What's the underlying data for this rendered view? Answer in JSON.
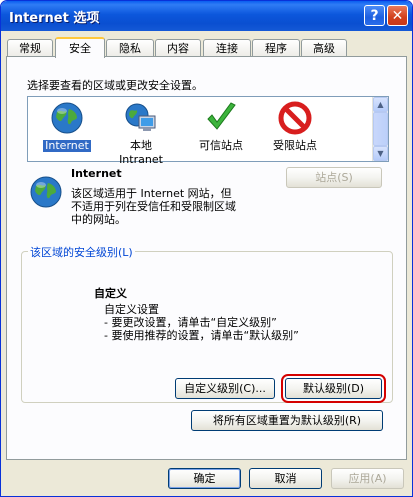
{
  "window": {
    "title": "Internet 选项",
    "help_label": "?",
    "close_label": "✕"
  },
  "tabs": [
    {
      "label": "常规",
      "active": false
    },
    {
      "label": "安全",
      "active": true
    },
    {
      "label": "隐私",
      "active": false
    },
    {
      "label": "内容",
      "active": false
    },
    {
      "label": "连接",
      "active": false
    },
    {
      "label": "程序",
      "active": false
    },
    {
      "label": "高级",
      "active": false
    }
  ],
  "zones": {
    "prompt": "选择要查看的区域或更改安全设置。",
    "items": [
      {
        "label": "Internet",
        "icon": "globe-icon",
        "selected": true
      },
      {
        "label": "本地\nIntranet",
        "line1": "本地",
        "line2": "Intranet",
        "icon": "intranet-icon",
        "selected": false
      },
      {
        "label": "可信站点",
        "icon": "checkmark-icon",
        "selected": false
      },
      {
        "label": "受限站点",
        "icon": "restricted-icon",
        "selected": false
      }
    ]
  },
  "zone_detail": {
    "name": "Internet",
    "description_line1": "该区域适用于 Internet 网站，但",
    "description_line2": "不适用于列在受信任和受限制区域",
    "description_line3": "中的网站。",
    "sites_button": "站点(S)",
    "sites_button_key": "S"
  },
  "security_level": {
    "group_title": "该区域的安全级别(L)",
    "level_name": "自定义",
    "line1": "自定义设置",
    "line2": "- 要更改设置，请单击“自定义级别”",
    "line3": "- 要使用推荐的设置，请单击“默认级别”",
    "custom_button": "自定义级别(C)...",
    "default_button": "默认级别(D)",
    "reset_all_button": "将所有区域重置为默认级别(R)"
  },
  "footer": {
    "ok": "确定",
    "cancel": "取消",
    "apply": "应用(A)"
  },
  "colors": {
    "titlebar": "#0a4fd1",
    "selection": "#316ac5",
    "group_title": "#0046d5",
    "highlight_outline": "#d40000"
  }
}
